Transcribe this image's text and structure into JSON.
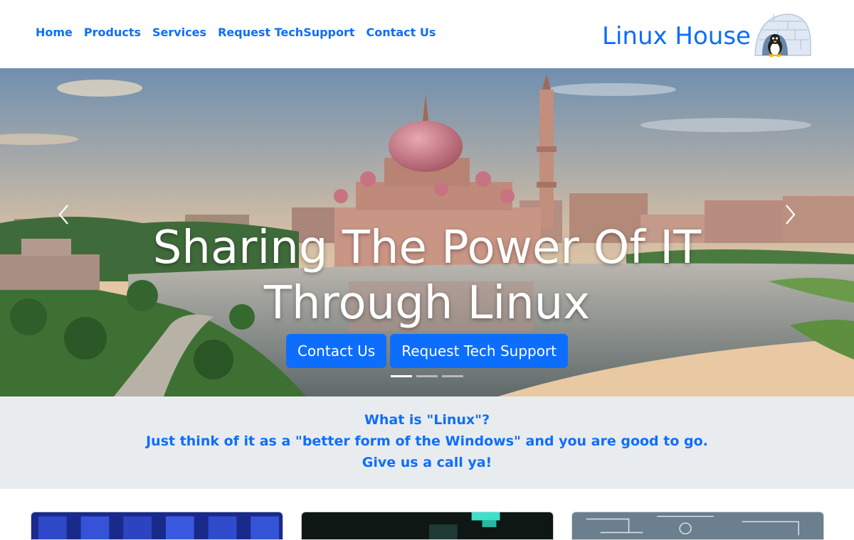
{
  "nav": {
    "items": [
      {
        "label": "Home"
      },
      {
        "label": "Products"
      },
      {
        "label": "Services"
      },
      {
        "label": "Request TechSupport"
      },
      {
        "label": "Contact Us"
      }
    ],
    "brand": "Linux House"
  },
  "hero": {
    "title_line1": "Sharing The Power Of IT",
    "title_line2": "Through Linux",
    "buttons": {
      "contact": "Contact Us",
      "support": "Request Tech Support"
    },
    "indicators": 3,
    "active_slide": 1
  },
  "info": {
    "line1": "What is \"Linux\"?",
    "line2": "Just think of it as a \"better form of the Windows\" and you are good to go.",
    "line3": "Give us a call ya!"
  },
  "colors": {
    "accent": "#0d6efd",
    "band": "#e9ecef"
  },
  "icons": {
    "prev": "chevron-left-icon",
    "next": "chevron-right-icon",
    "logo": "igloo-penguin-logo"
  }
}
